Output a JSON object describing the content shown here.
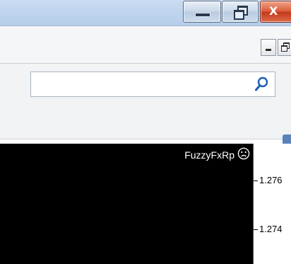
{
  "window": {
    "controls": {
      "minimize_icon": "minimize-icon",
      "restore_icon": "restore-icon",
      "close_glyph": "X"
    }
  },
  "mdi": {
    "minimize_icon": "minimize-icon",
    "restore_icon": "restore-icon"
  },
  "search": {
    "value": "",
    "placeholder": "",
    "icon": "search-icon"
  },
  "chart": {
    "indicator_name": "FuzzyFxRp",
    "indicator_status_icon": "sad-face-icon",
    "price_labels": [
      "1.276",
      "1.274"
    ],
    "background": "#000000",
    "text_color": "#ffffff"
  }
}
